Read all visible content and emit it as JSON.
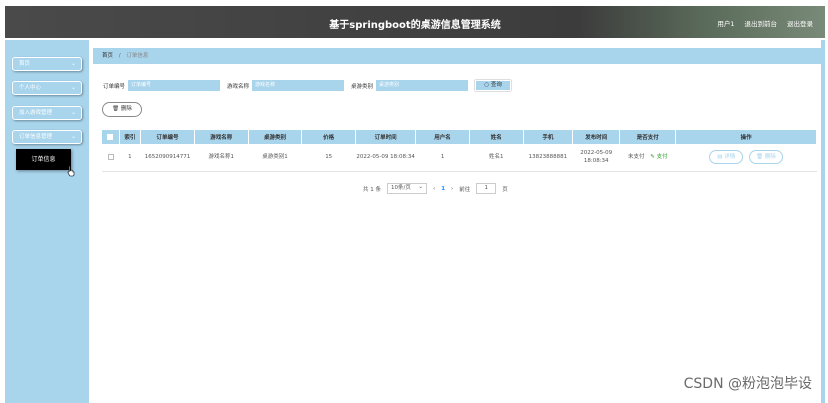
{
  "header": {
    "title": "基于springboot的桌游信息管理系统",
    "user": "用户1",
    "back_to_front": "退出到前台",
    "logout": "退出登录"
  },
  "sidebar": {
    "items": [
      {
        "label": "首页"
      },
      {
        "label": "个人中心"
      },
      {
        "label": "加入游戏管理"
      },
      {
        "label": "订单信息管理"
      }
    ],
    "submenu": {
      "label": "订单信息"
    }
  },
  "breadcrumb": {
    "home": "首页",
    "current": "订单信息"
  },
  "search": {
    "order_no_label": "订单编号",
    "order_no_placeholder": "订单编号",
    "game_name_label": "游戏名称",
    "game_name_placeholder": "游戏名称",
    "category_label": "桌游类别",
    "category_placeholder": "桌游类别",
    "button": "查询"
  },
  "toolbar": {
    "delete_label": "删除"
  },
  "table": {
    "headers": [
      "索引",
      "订单编号",
      "游戏名称",
      "桌游类别",
      "价格",
      "订单时间",
      "用户名",
      "姓名",
      "手机",
      "发布时间",
      "是否支付",
      "操作"
    ],
    "rows": [
      {
        "index": "1",
        "order_no": "1652090914771",
        "game_name": "游戏名称1",
        "category": "桌游类别1",
        "price": "15",
        "order_time": "2022-05-09 18:08:34",
        "username": "1",
        "name": "姓名1",
        "phone": "13823888881",
        "publish_time": "2022-05-09 18:08:34",
        "paid_status": "未支付",
        "pay_link": "支付",
        "detail_label": "详情",
        "delete_label": "删除"
      }
    ]
  },
  "pagination": {
    "total": "共 1 条",
    "page_size": "10条/页",
    "prev": "‹",
    "current_page": "1",
    "next": "›",
    "goto_label": "前往",
    "goto_value": "1",
    "page_suffix": "页"
  },
  "watermark": "CSDN @粉泡泡毕设"
}
